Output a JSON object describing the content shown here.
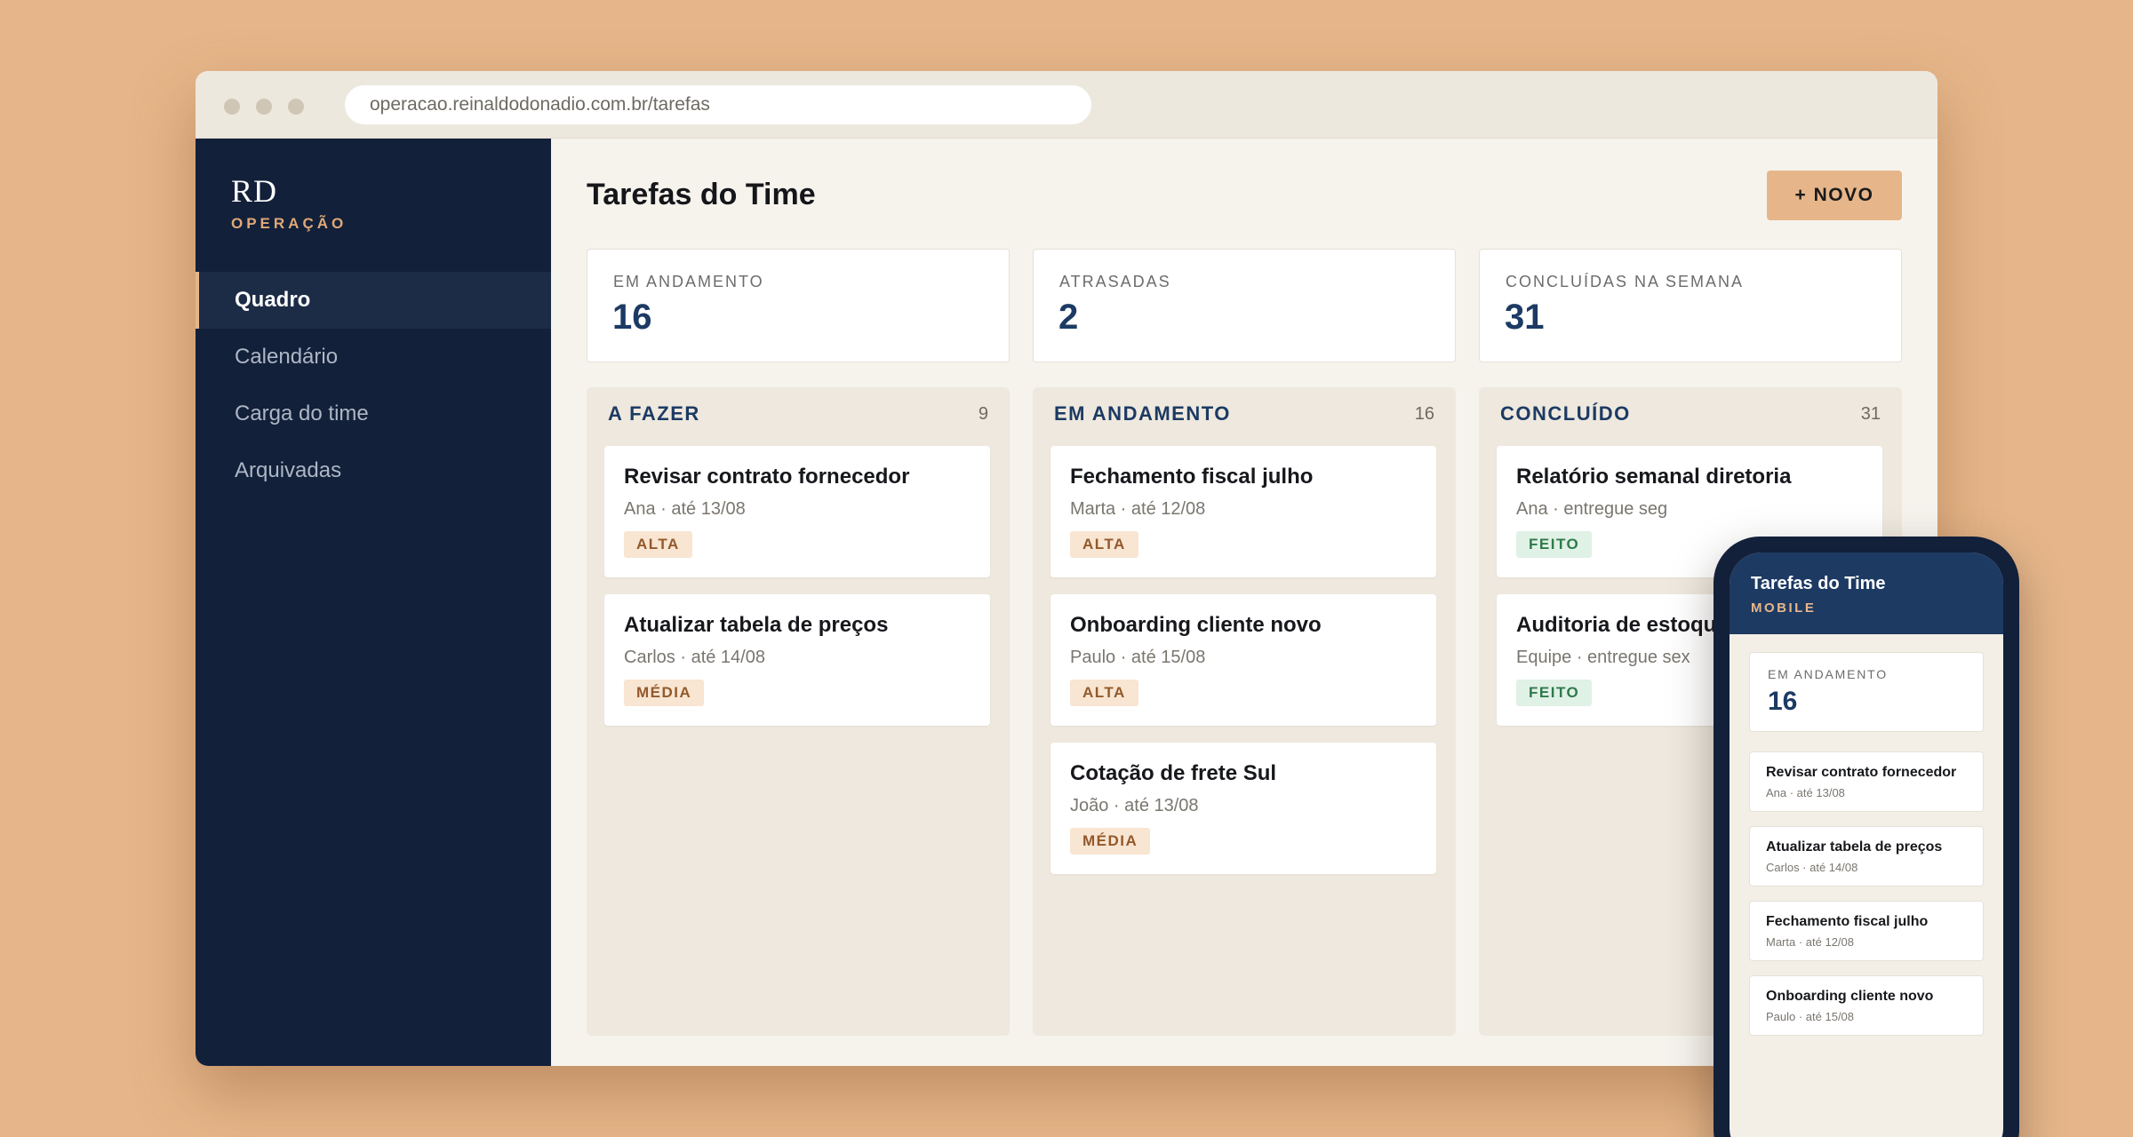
{
  "browser": {
    "url": "operacao.reinaldodonadio.com.br/tarefas"
  },
  "sidebar": {
    "brand": "RD",
    "brand_sub": "OPERAÇÃO",
    "items": [
      {
        "label": "Quadro",
        "active": true
      },
      {
        "label": "Calendário",
        "active": false
      },
      {
        "label": "Carga do time",
        "active": false
      },
      {
        "label": "Arquivadas",
        "active": false
      }
    ]
  },
  "header": {
    "title": "Tarefas do Time",
    "new_button": "+ NOVO"
  },
  "stats": [
    {
      "label": "EM ANDAMENTO",
      "value": "16"
    },
    {
      "label": "ATRASADAS",
      "value": "2"
    },
    {
      "label": "CONCLUÍDAS NA SEMANA",
      "value": "31"
    }
  ],
  "columns": [
    {
      "title": "A FAZER",
      "count": "9",
      "cards": [
        {
          "title": "Revisar contrato fornecedor",
          "meta": "Ana · até 13/08",
          "tag": "ALTA"
        },
        {
          "title": "Atualizar tabela de preços",
          "meta": "Carlos · até 14/08",
          "tag": "MÉDIA"
        }
      ]
    },
    {
      "title": "EM ANDAMENTO",
      "count": "16",
      "cards": [
        {
          "title": "Fechamento fiscal julho",
          "meta": "Marta · até 12/08",
          "tag": "ALTA"
        },
        {
          "title": "Onboarding cliente novo",
          "meta": "Paulo · até 15/08",
          "tag": "ALTA"
        },
        {
          "title": "Cotação de frete Sul",
          "meta": "João · até 13/08",
          "tag": "MÉDIA"
        }
      ]
    },
    {
      "title": "CONCLUÍDO",
      "count": "31",
      "cards": [
        {
          "title": "Relatório semanal diretoria",
          "meta": "Ana · entregue seg",
          "tag": "FEITO"
        },
        {
          "title": "Auditoria de estoque",
          "meta": "Equipe · entregue sex",
          "tag": "FEITO"
        }
      ]
    }
  ],
  "mobile": {
    "title": "Tarefas do Time",
    "subtitle": "MOBILE",
    "stat": {
      "label": "EM ANDAMENTO",
      "value": "16"
    },
    "items": [
      {
        "title": "Revisar contrato fornecedor",
        "meta": "Ana · até 13/08"
      },
      {
        "title": "Atualizar tabela de preços",
        "meta": "Carlos · até 14/08"
      },
      {
        "title": "Fechamento fiscal julho",
        "meta": "Marta · até 12/08"
      },
      {
        "title": "Onboarding cliente novo",
        "meta": "Paulo · até 15/08"
      }
    ]
  },
  "colors": {
    "background": "#e6b68a",
    "sidebar": "#12203a",
    "accent": "#e6b68a",
    "heading_blue": "#1c3a63",
    "tag_priority_bg": "#f8e5d2",
    "tag_done_bg": "#e0f1e6"
  }
}
